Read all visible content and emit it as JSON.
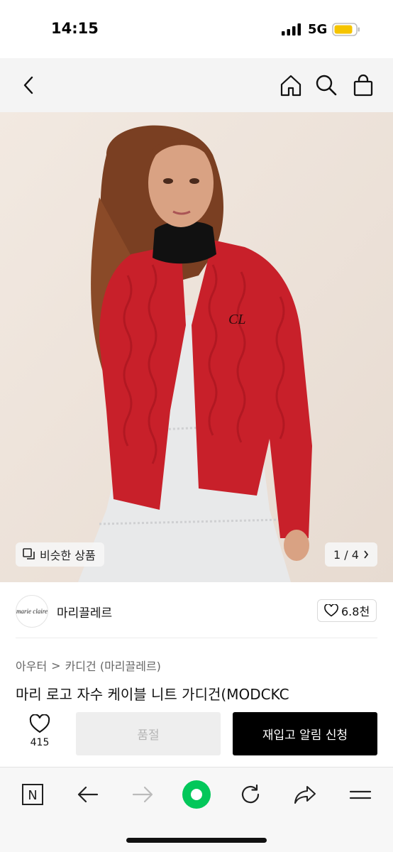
{
  "status_bar": {
    "time": "14:15",
    "network": "5G"
  },
  "nav": {
    "icons": [
      "back-chevron-icon",
      "home-icon",
      "search-icon",
      "shopping-bag-icon"
    ]
  },
  "hero": {
    "similar_label": "비슷한 상품",
    "pager": "1 / 4",
    "colors": {
      "sweater": "#c8202a",
      "background": "#efe5dd",
      "dress": "#e8e9ea"
    }
  },
  "brand": {
    "logo_text": "marie claire",
    "name": "마리끌레르",
    "likes": "6.8천"
  },
  "breadcrumb": {
    "level1": "아우터",
    "separator": ">",
    "level2": "카디건 (마리끌레르)"
  },
  "product": {
    "title": "마리 로고 자수 케이블 니트 가디건(MODCKC"
  },
  "actions": {
    "wish_count": "415",
    "soldout_label": "품절",
    "restock_label": "재입고 알림 신청"
  },
  "browser_bar": {
    "n_label": "N",
    "icons": [
      "naver-n-icon",
      "back-arrow-icon",
      "forward-arrow-icon",
      "green-dot-icon",
      "reload-icon",
      "share-icon",
      "menu-icon"
    ],
    "accent": "#03c75a"
  }
}
